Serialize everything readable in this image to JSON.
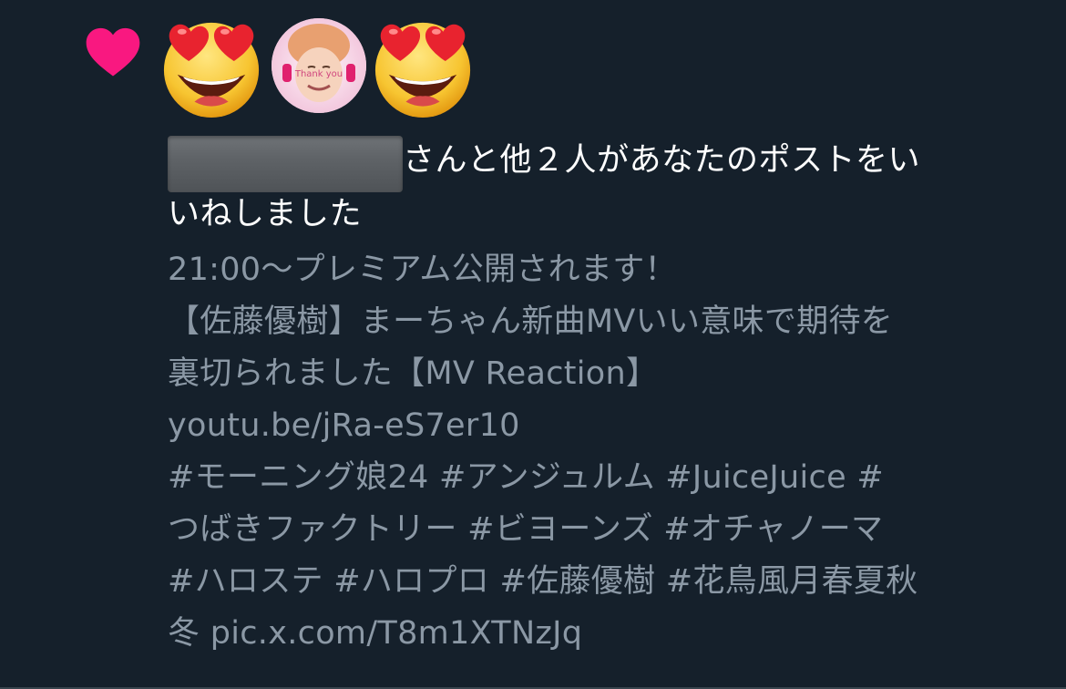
{
  "notification": {
    "icon": "heart-icon",
    "accent_color": "#f91880",
    "avatars": [
      {
        "type": "emoji",
        "name": "heart-eyes-emoji-icon"
      },
      {
        "type": "photo",
        "name": "user-avatar",
        "caption": "Thank you"
      },
      {
        "type": "emoji",
        "name": "heart-eyes-emoji-icon"
      }
    ],
    "name_redacted": true,
    "text_part1": "さんと他２人があなたのポストをい",
    "text_part2": "いねしました"
  },
  "post": {
    "lines": [
      "21:00～プレミアム公開されます！",
      "【佐藤優樹】まーちゃん新曲MVいい意味で期待を",
      "裏切られました【MV Reaction】",
      "youtu.be/jRa-eS7er10",
      "#モーニング娘24 #アンジュルム #JuiceJuice #",
      "つばきファクトリー #ビヨーンズ #オチャノーマ",
      "#ハロステ #ハロプロ #佐藤優樹 #花鳥風月春夏秋",
      "冬 pic.x.com/T8m1XTNzJq"
    ]
  },
  "colors": {
    "background": "#15202b",
    "primary_text": "#ffffff",
    "secondary_text": "#8b98a5",
    "divider": "#38444d"
  }
}
